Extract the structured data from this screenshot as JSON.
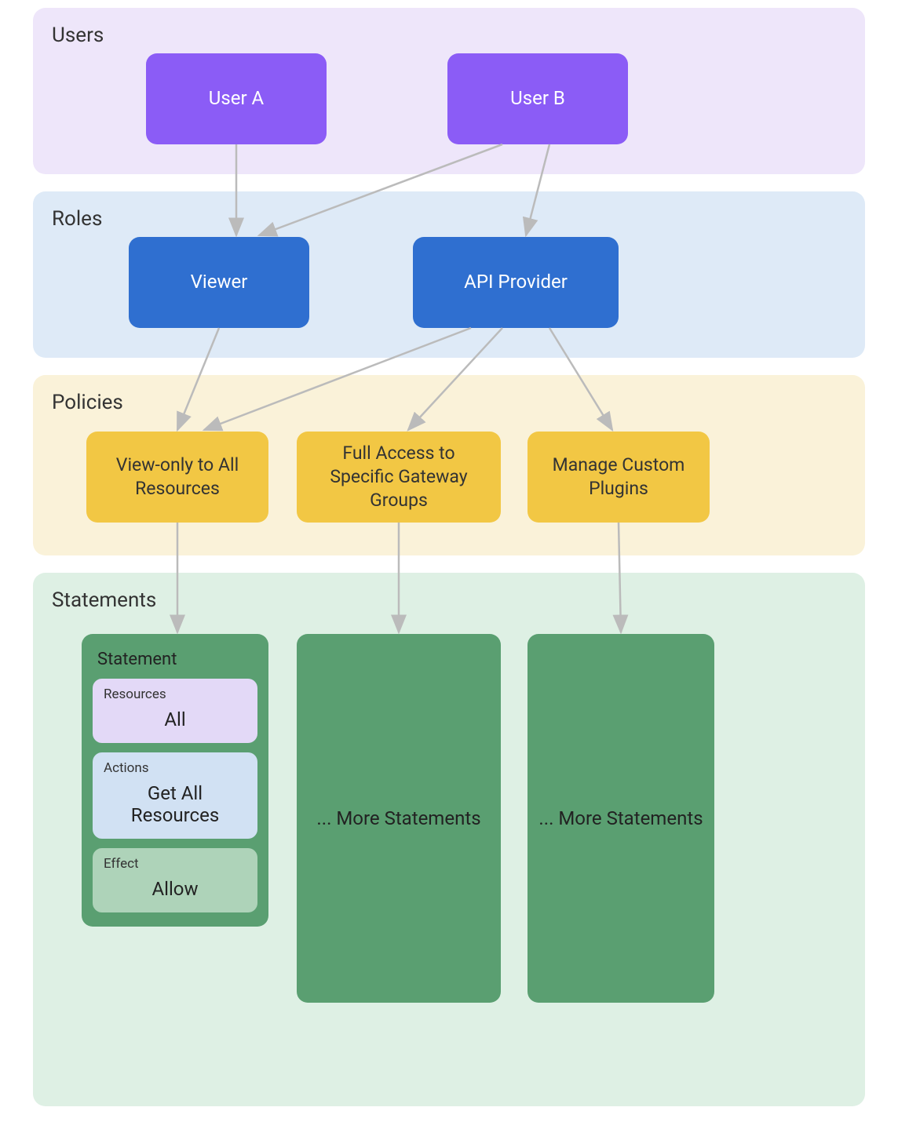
{
  "sections": {
    "users": {
      "title": "Users",
      "bg": "#eee6fa"
    },
    "roles": {
      "title": "Roles",
      "bg": "#deeaf7"
    },
    "policies": {
      "title": "Policies",
      "bg": "#faf2d9"
    },
    "statements": {
      "title": "Statements",
      "bg": "#def0e4"
    }
  },
  "users": {
    "a": "User A",
    "b": "User B"
  },
  "roles": {
    "viewer": "Viewer",
    "api_provider": "API Provider"
  },
  "policies": {
    "view_only": "View-only to All Resources",
    "full_access": "Full Access to Specific Gateway Groups",
    "manage_plugins": "Manage Custom Plugins"
  },
  "statements": {
    "card_title": "Statement",
    "resources": {
      "label": "Resources",
      "value": "All"
    },
    "actions": {
      "label": "Actions",
      "value": "Get All Resources"
    },
    "effect": {
      "label": "Effect",
      "value": "Allow"
    },
    "more": "... More Statements"
  },
  "edges": [
    {
      "from": "user-a",
      "to": "role-viewer"
    },
    {
      "from": "user-b",
      "to": "role-viewer"
    },
    {
      "from": "user-b",
      "to": "role-api-provider"
    },
    {
      "from": "role-viewer",
      "to": "policy-view-only"
    },
    {
      "from": "role-api-provider",
      "to": "policy-view-only"
    },
    {
      "from": "role-api-provider",
      "to": "policy-full-access"
    },
    {
      "from": "role-api-provider",
      "to": "policy-manage-plugins"
    },
    {
      "from": "policy-view-only",
      "to": "statement-card"
    },
    {
      "from": "policy-full-access",
      "to": "more-statements-1"
    },
    {
      "from": "policy-manage-plugins",
      "to": "more-statements-2"
    }
  ]
}
